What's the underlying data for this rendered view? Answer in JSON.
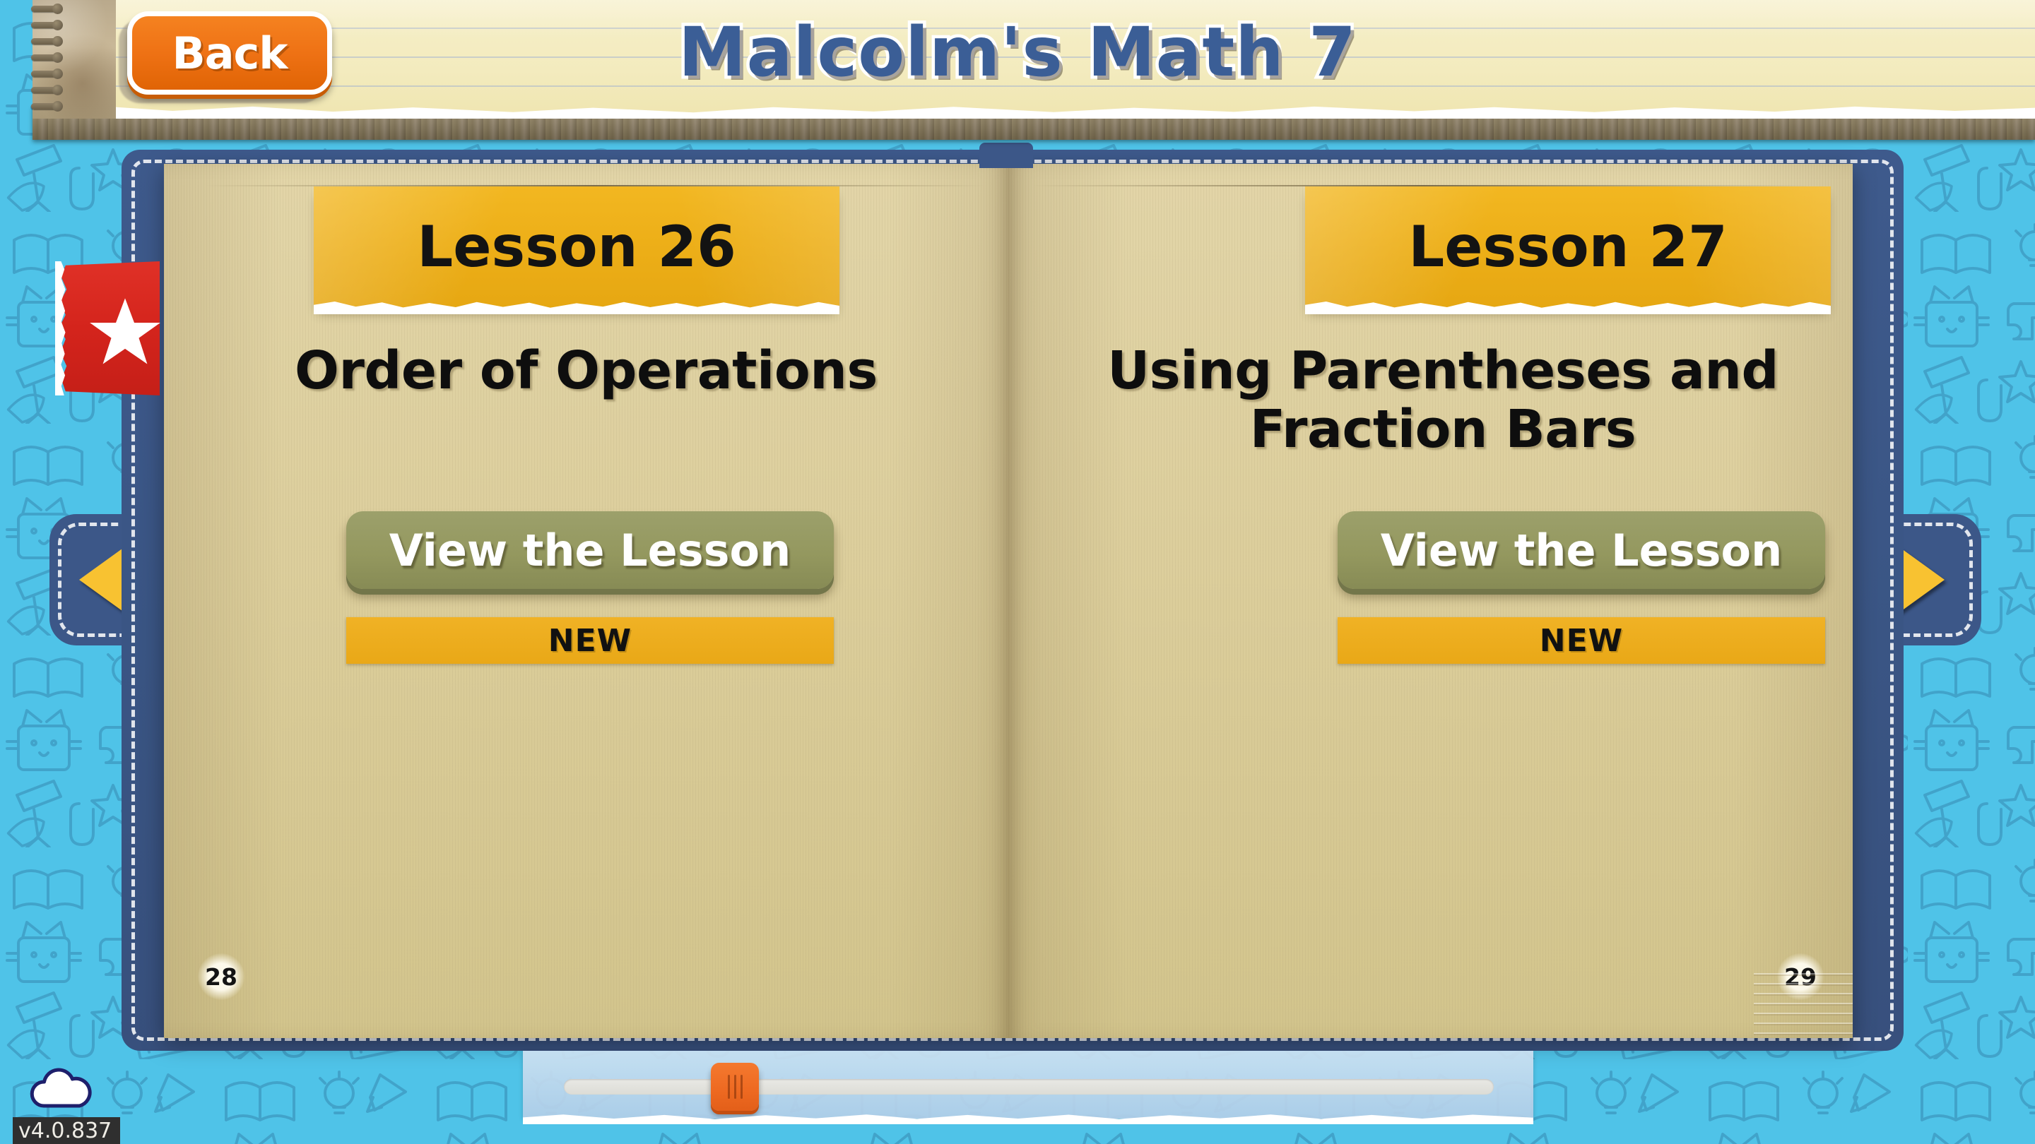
{
  "app": {
    "title": "Malcolm's Math 7",
    "version": "v4.0.837"
  },
  "header": {
    "back_label": "Back",
    "back_icon": "back-button",
    "spiral_icon": "spiral-binding-icon"
  },
  "bookmark": {
    "icon": "star-bookmark-icon"
  },
  "navigation": {
    "prev_icon": "triangle-left-icon",
    "prev_label": "Previous page",
    "next_icon": "triangle-right-icon",
    "next_label": "Next page"
  },
  "pages": [
    {
      "side": "left",
      "banner": "Lesson 26",
      "title": "Order of Operations",
      "title_lines": [
        "Order of Operations"
      ],
      "button_label": "View the Lesson",
      "badge_label": "NEW",
      "page_number": "28"
    },
    {
      "side": "right",
      "banner": "Lesson 27",
      "title": "Using Parentheses and Fraction Bars",
      "title_lines": [
        "Using Parentheses and",
        "Fraction Bars"
      ],
      "button_label": "View the Lesson",
      "badge_label": "NEW",
      "page_number": "29"
    }
  ],
  "slider": {
    "name": "page-scroll-slider",
    "thumb_icon": "grip-handle-icon",
    "thumb_position_percent": 17
  },
  "status": {
    "cloud_icon": "cloud-sync-icon"
  },
  "colors": {
    "background_cyan": "#4FC3E8",
    "doodle_line": "#3E9EC4",
    "book_frame_blue": "#3C5788",
    "page_tan": "#DCCE9C",
    "banner_gold": "#EDAF18",
    "button_olive": "#94985F",
    "badge_amber": "#E9A817",
    "back_orange": "#EE7114",
    "title_blue": "#3B5E96",
    "arrow_yellow": "#F8C231",
    "bookmark_red": "#D4241C",
    "slider_orange": "#EE6A22"
  }
}
